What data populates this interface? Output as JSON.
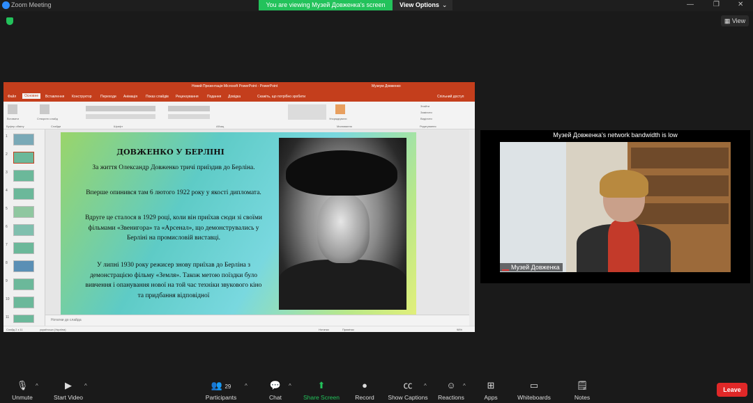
{
  "window": {
    "title": "Zoom Meeting",
    "share_banner": "You are viewing Музей Довженка's screen",
    "view_options": "View Options",
    "view_button": "View",
    "minimize": "—",
    "restore": "❐",
    "close": "✕"
  },
  "powerpoint": {
    "title": "Новий Презентація Microsoft PowerPoint - PowerPoint",
    "user": "Музеум Довженко",
    "tabs": [
      "Файл",
      "Основне",
      "Вставлення",
      "Конструктор",
      "Переходи",
      "Анімація",
      "Показ слайдів",
      "Рецензування",
      "Подання",
      "Довідка",
      "Скажіть, що потрібно зробити",
      "Спільний доступ"
    ],
    "ribbon_groups": [
      "Буфер обміну",
      "Слайди",
      "Шрифт",
      "Абзац",
      "Малювання",
      "Редагування"
    ],
    "ribbon_buttons": [
      "Вставити",
      "Створити слайд",
      "Упорядкувати",
      "Знайти",
      "Замінити",
      "Виділити"
    ],
    "thumbnail_numbers": [
      "1",
      "2",
      "3",
      "4",
      "5",
      "6",
      "7",
      "8",
      "9",
      "10",
      "11"
    ],
    "notes_placeholder": "Нотатки до слайда",
    "status_left": "Слайд 2 з 11",
    "status_lang": "українська (Україна)",
    "status_notes": "Нотатки",
    "status_comments": "Примітки",
    "zoom_level": "98%"
  },
  "slide": {
    "heading": "ДОВЖЕНКО У БЕРЛІНІ",
    "p1": "За життя Олександр Довженко тричі приїздив до Берліна.",
    "p2": "Вперше опинився там 6 лютого 1922 року у якості дипломата.",
    "p3": "Вдруге це сталося в 1929 році, коли він приїхав сюди зі своїми фільмами «Звенигора» та «Арсенал», що демонструвались у Берліні на промисловій виставці.",
    "p4": "У липні 1930 року режисер знову приїхав до Берліна з демонстрацією фільму «Земля». Також метою поїздки було вивчення і опанування нової на той час техніки звукового кіно та придбання відповідної"
  },
  "participant_video": {
    "bandwidth_note": "Музей Довженка's network bandwidth is low",
    "name": "Музей Довженка"
  },
  "toolbar": {
    "unmute": "Unmute",
    "start_video": "Start Video",
    "participants": "Participants",
    "participants_count": "29",
    "chat": "Chat",
    "share_screen": "Share Screen",
    "record": "Record",
    "show_captions": "Show Captions",
    "reactions": "Reactions",
    "apps": "Apps",
    "whiteboards": "Whiteboards",
    "notes": "Notes",
    "leave": "Leave"
  },
  "colors": {
    "zoom_blue": "#2d8cff",
    "share_green": "#23c25b",
    "ppt_red": "#c43e1c",
    "leave_red": "#e02828"
  }
}
